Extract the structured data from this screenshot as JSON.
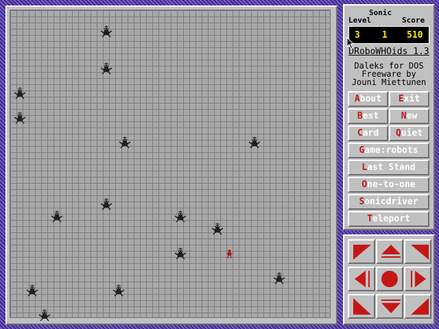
{
  "status": {
    "mode": "Sonic",
    "level_label": "Level",
    "score_label": "Score",
    "level": "3",
    "middle": "1",
    "score": "510"
  },
  "info": {
    "title": "DRoboWHOids 1.3",
    "line1": "Daleks for DOS",
    "line2": "Freeware by",
    "line3": "Jouni Miettunen"
  },
  "buttons": {
    "about": {
      "key": "A",
      "rest": "bout"
    },
    "exit": {
      "key": "E",
      "rest": "xit"
    },
    "best": {
      "key": "B",
      "rest": "est"
    },
    "new": {
      "key": "N",
      "rest": "ew"
    },
    "card": {
      "key": "C",
      "rest": "ard"
    },
    "quiet": {
      "key": "Q",
      "rest": "uiet"
    },
    "game": {
      "key": "G",
      "rest": "ame:robots"
    },
    "last_stand": {
      "key": "L",
      "rest": "ast Stand"
    },
    "one_to_one": {
      "key": "O",
      "rest": "ne-to-one"
    },
    "sonicdriver": {
      "key": "S",
      "rest": "onicdriver"
    },
    "teleport": {
      "key": "T",
      "rest": "eleport"
    }
  },
  "colors": {
    "background": "#5a3fae",
    "panel": "#c0c0c0",
    "hotkey": "#c41818",
    "arrow": "#c41818",
    "score_text": "#ffea00",
    "robot": "#202020",
    "player": "#b01818"
  },
  "board": {
    "cols": 52,
    "rows": 50,
    "robots": [
      {
        "col": 15,
        "row": 3
      },
      {
        "col": 15,
        "row": 9
      },
      {
        "col": 1,
        "row": 13
      },
      {
        "col": 1,
        "row": 17
      },
      {
        "col": 18,
        "row": 21
      },
      {
        "col": 39,
        "row": 21
      },
      {
        "col": 15,
        "row": 31
      },
      {
        "col": 7,
        "row": 33
      },
      {
        "col": 27,
        "row": 33
      },
      {
        "col": 33,
        "row": 35
      },
      {
        "col": 27,
        "row": 39
      },
      {
        "col": 43,
        "row": 43
      },
      {
        "col": 3,
        "row": 45
      },
      {
        "col": 17,
        "row": 45
      },
      {
        "col": 5,
        "row": 49
      }
    ],
    "player": {
      "col": 35,
      "row": 39
    }
  },
  "pad": {
    "buttons": [
      {
        "name": "move-up-left-button",
        "icon": "arrow-up-left-icon"
      },
      {
        "name": "move-up-button",
        "icon": "arrow-up-icon"
      },
      {
        "name": "move-up-right-button",
        "icon": "arrow-up-right-icon"
      },
      {
        "name": "move-left-button",
        "icon": "arrow-left-icon"
      },
      {
        "name": "wait-button",
        "icon": "circle-icon"
      },
      {
        "name": "move-right-button",
        "icon": "arrow-right-icon"
      },
      {
        "name": "move-down-left-button",
        "icon": "arrow-down-left-icon"
      },
      {
        "name": "move-down-button",
        "icon": "arrow-down-icon"
      },
      {
        "name": "move-down-right-button",
        "icon": "arrow-down-right-icon"
      }
    ]
  }
}
